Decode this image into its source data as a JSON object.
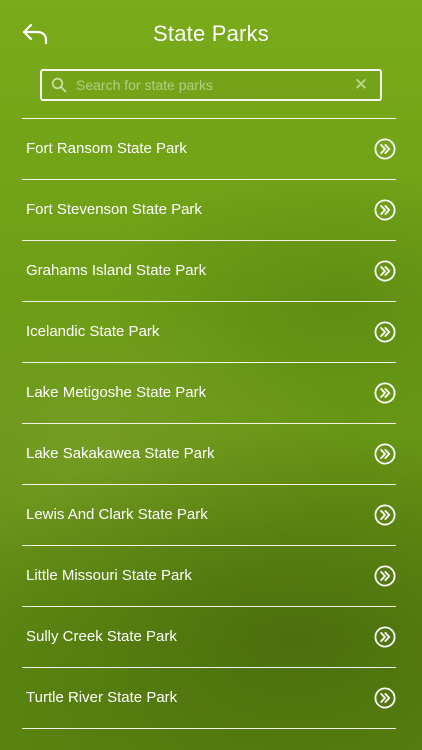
{
  "header": {
    "title": "State Parks",
    "back_icon": "back-arrow-icon"
  },
  "search": {
    "placeholder": "Search for state parks",
    "value": "",
    "search_icon": "search-icon",
    "clear_icon": "clear-icon",
    "clear_glyph": "✕"
  },
  "list": {
    "items": [
      {
        "label": "Fort Ransom State Park"
      },
      {
        "label": "Fort Stevenson State Park"
      },
      {
        "label": "Grahams Island State Park"
      },
      {
        "label": "Icelandic State Park"
      },
      {
        "label": "Lake Metigoshe State Park"
      },
      {
        "label": "Lake Sakakawea State Park"
      },
      {
        "label": "Lewis And Clark State Park"
      },
      {
        "label": "Little Missouri State Park"
      },
      {
        "label": "Sully Creek State Park"
      },
      {
        "label": "Turtle River State Park"
      }
    ],
    "item_icon": "double-chevron-right-icon"
  },
  "colors": {
    "accent": "#6e9e17",
    "text": "#ffffff"
  }
}
